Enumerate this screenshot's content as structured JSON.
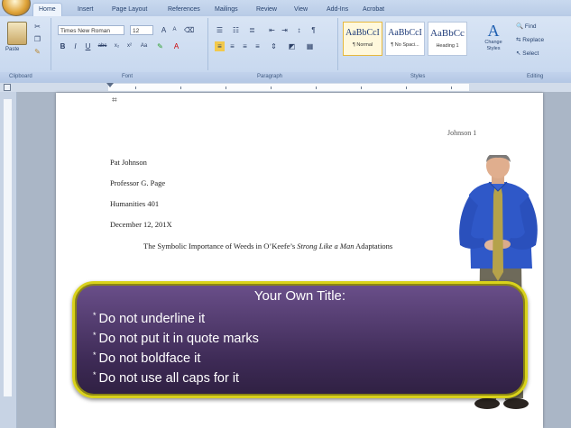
{
  "ribbon": {
    "tabs": [
      "Home",
      "Insert",
      "Page Layout",
      "References",
      "Mailings",
      "Review",
      "View",
      "Add-Ins",
      "Acrobat"
    ],
    "font_name": "Times New Roman",
    "font_size": "12",
    "paste_label": "Paste",
    "groups": [
      "Clipboard",
      "Font",
      "Paragraph",
      "Styles",
      "Editing"
    ],
    "styles": [
      {
        "sample": "AaBbCcI",
        "name": "¶ Normal"
      },
      {
        "sample": "AaBbCcI",
        "name": "¶ No Spaci..."
      },
      {
        "sample": "AaBbCc",
        "name": "Heading 1"
      }
    ],
    "change_styles": "Change Styles",
    "editing": [
      "Find",
      "Replace",
      "Select"
    ]
  },
  "document": {
    "header": "Johnson 1",
    "lines": [
      "Pat Johnson",
      "Professor G. Page",
      "Humanities 401",
      "December 12, 201X"
    ],
    "title_prefix": "The Symbolic Importance of Weeds in O’Keefe’s ",
    "title_italic": "Strong Like a Man",
    "title_suffix": " Adaptations"
  },
  "caption": {
    "title": "Your Own Title:",
    "bullets": [
      "Do not underline it",
      "Do not put it in quote marks",
      "Do not boldface it",
      "Do not use all caps for it"
    ]
  },
  "colors": {
    "caption_border": "#d9d21b",
    "caption_bg": "#4a3568",
    "ribbon_bg": "#d3e1f3"
  }
}
